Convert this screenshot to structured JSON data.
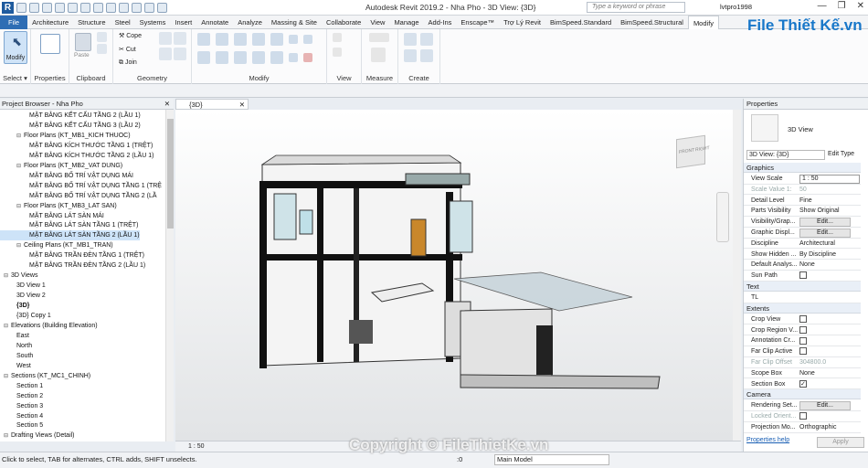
{
  "app": {
    "title": "Autodesk Revit 2019.2 - Nha Pho - 3D View: {3D}",
    "search_placeholder": "Type a keyword or phrase",
    "user": "lvtpro1998",
    "window_controls": [
      "—",
      "❐",
      "✕"
    ],
    "quick_access_icons": [
      "open-icon",
      "save-icon",
      "sync-icon",
      "undo-icon",
      "redo-icon",
      "print-icon",
      "measure-icon",
      "text-icon",
      "3d-view-icon",
      "section-icon",
      "thin-lines-icon",
      "close-views-icon"
    ]
  },
  "ribbon": {
    "tabs": [
      "File",
      "Architecture",
      "Structure",
      "Steel",
      "Systems",
      "Insert",
      "Annotate",
      "Analyze",
      "Massing & Site",
      "Collaborate",
      "View",
      "Manage",
      "Add-Ins",
      "Enscape™",
      "Trợ Lý Revit",
      "BimSpeed.Standard",
      "BimSpeed.Structural",
      "Modify"
    ],
    "active_tab": "Modify",
    "groups": [
      {
        "label": "Select ▾"
      },
      {
        "label": "Properties"
      },
      {
        "label": "Clipboard"
      },
      {
        "label": "Geometry"
      },
      {
        "label": "Modify"
      },
      {
        "label": "View"
      },
      {
        "label": "Measure"
      },
      {
        "label": "Create"
      }
    ],
    "modify_button": "Modify",
    "geometry_labels": {
      "cope": "Cope",
      "cut": "Cut",
      "join": "Join"
    },
    "paste_label": "Paste"
  },
  "brand": "File Thiết Kế.vn",
  "project_browser": {
    "title": "Project Browser - Nha Pho",
    "items": [
      {
        "level": 3,
        "text": "MẶT BẰNG KẾT CẤU TẦNG 2 (LẦU 1)"
      },
      {
        "level": 3,
        "text": "MẶT BẰNG KẾT CẤU TẦNG 3 (LẦU 2)"
      },
      {
        "level": 2,
        "toggle": "⊟",
        "text": "Floor Plans (KT_MB1_KICH THUOC)"
      },
      {
        "level": 3,
        "text": "MẶT BẰNG KÍCH THƯỚC TẦNG 1 (TRỆT)"
      },
      {
        "level": 3,
        "text": "MẶT BẰNG KÍCH THƯỚC TẦNG 2 (LẦU 1)"
      },
      {
        "level": 2,
        "toggle": "⊟",
        "text": "Floor Plans (KT_MB2_VAT DUNG)"
      },
      {
        "level": 3,
        "text": "MẶT BẰNG BỐ TRÍ VẬT DỤNG MÁI"
      },
      {
        "level": 3,
        "text": "MẶT BẰNG BỐ TRÍ VẬT DỤNG TẦNG 1 (TRỆ"
      },
      {
        "level": 3,
        "text": "MẶT BẰNG BỐ TRÍ VẬT DỤNG TẦNG 2 (LẦ"
      },
      {
        "level": 2,
        "toggle": "⊟",
        "text": "Floor Plans (KT_MB3_LAT SAN)"
      },
      {
        "level": 3,
        "text": "MẶT BẰNG LÁT SÀN MÁI"
      },
      {
        "level": 3,
        "text": "MẶT BẰNG LÁT SÀN TẦNG 1 (TRỆT)"
      },
      {
        "level": 3,
        "text": "MẶT BẰNG LÁT SÀN TẦNG 2 (LẦU 1)",
        "selected": true
      },
      {
        "level": 2,
        "toggle": "⊟",
        "text": "Ceiling Plans (KT_MB1_TRAN)"
      },
      {
        "level": 3,
        "text": "MẶT BẰNG TRẦN ĐÈN TẦNG 1 (TRỆT)"
      },
      {
        "level": 3,
        "text": "MẶT BẰNG TRẦN ĐÈN TẦNG 2 (LẦU 1)"
      },
      {
        "level": 1,
        "toggle": "⊟",
        "text": "3D Views"
      },
      {
        "level": 2,
        "text": "3D View 1"
      },
      {
        "level": 2,
        "text": "3D View 2"
      },
      {
        "level": 2,
        "text": "{3D}",
        "bold": true
      },
      {
        "level": 2,
        "text": "{3D} Copy 1"
      },
      {
        "level": 1,
        "toggle": "⊟",
        "text": "Elevations (Building Elevation)"
      },
      {
        "level": 2,
        "text": "East"
      },
      {
        "level": 2,
        "text": "North"
      },
      {
        "level": 2,
        "text": "South"
      },
      {
        "level": 2,
        "text": "West"
      },
      {
        "level": 1,
        "toggle": "⊟",
        "text": "Sections (KT_MC1_CHINH)"
      },
      {
        "level": 2,
        "text": "Section 1"
      },
      {
        "level": 2,
        "text": "Section 2"
      },
      {
        "level": 2,
        "text": "Section 3"
      },
      {
        "level": 2,
        "text": "Section 4"
      },
      {
        "level": 2,
        "text": "Section 5"
      },
      {
        "level": 1,
        "toggle": "⊟",
        "text": "Drafting Views (Detail)"
      }
    ]
  },
  "view": {
    "tab": "{3D}",
    "scale": "1 : 50",
    "viewcube": {
      "front": "FRONT",
      "right": "RIGHT"
    }
  },
  "properties": {
    "title": "Properties",
    "type_name": "3D View",
    "instance_selector": "3D View: {3D}",
    "edit_type": "Edit Type",
    "sections": [
      {
        "name": "Graphics",
        "rows": [
          {
            "k": "View Scale",
            "v": "1 : 50",
            "field": true
          },
          {
            "k": "Scale Value    1:",
            "v": "50",
            "disabled": true
          },
          {
            "k": "Detail Level",
            "v": "Fine"
          },
          {
            "k": "Parts Visibility",
            "v": "Show Original"
          },
          {
            "k": "Visibility/Grap...",
            "v": "Edit...",
            "button": true
          },
          {
            "k": "Graphic Displ...",
            "v": "Edit...",
            "button": true
          },
          {
            "k": "Discipline",
            "v": "Architectural"
          },
          {
            "k": "Show Hidden ...",
            "v": "By Discipline"
          },
          {
            "k": "Default Analys...",
            "v": "None"
          },
          {
            "k": "Sun Path",
            "v": "",
            "check": false
          }
        ]
      },
      {
        "name": "Text",
        "rows": [
          {
            "k": "TL",
            "v": ""
          }
        ]
      },
      {
        "name": "Extents",
        "rows": [
          {
            "k": "Crop View",
            "v": "",
            "check": false
          },
          {
            "k": "Crop Region V...",
            "v": "",
            "check": false
          },
          {
            "k": "Annotation Cr...",
            "v": "",
            "check": false
          },
          {
            "k": "Far Clip Active",
            "v": "",
            "check": false
          },
          {
            "k": "Far Clip Offset",
            "v": "304800.0",
            "disabled": true
          },
          {
            "k": "Scope Box",
            "v": "None"
          },
          {
            "k": "Section Box",
            "v": "",
            "check": true
          }
        ]
      },
      {
        "name": "Camera",
        "rows": [
          {
            "k": "Rendering Set...",
            "v": "Edit...",
            "button": true
          },
          {
            "k": "Locked Orient...",
            "v": "",
            "disabled": true,
            "check": false
          },
          {
            "k": "Projection Mo...",
            "v": "Orthographic"
          }
        ]
      }
    ],
    "help_link": "Properties help",
    "apply": "Apply"
  },
  "statusbar": {
    "hint": "Click to select, TAB for alternates, CTRL adds, SHIFT unselects.",
    "zero": ":0",
    "model": "Main Model"
  },
  "watermark": "Copyright © FileThietKe.vn"
}
